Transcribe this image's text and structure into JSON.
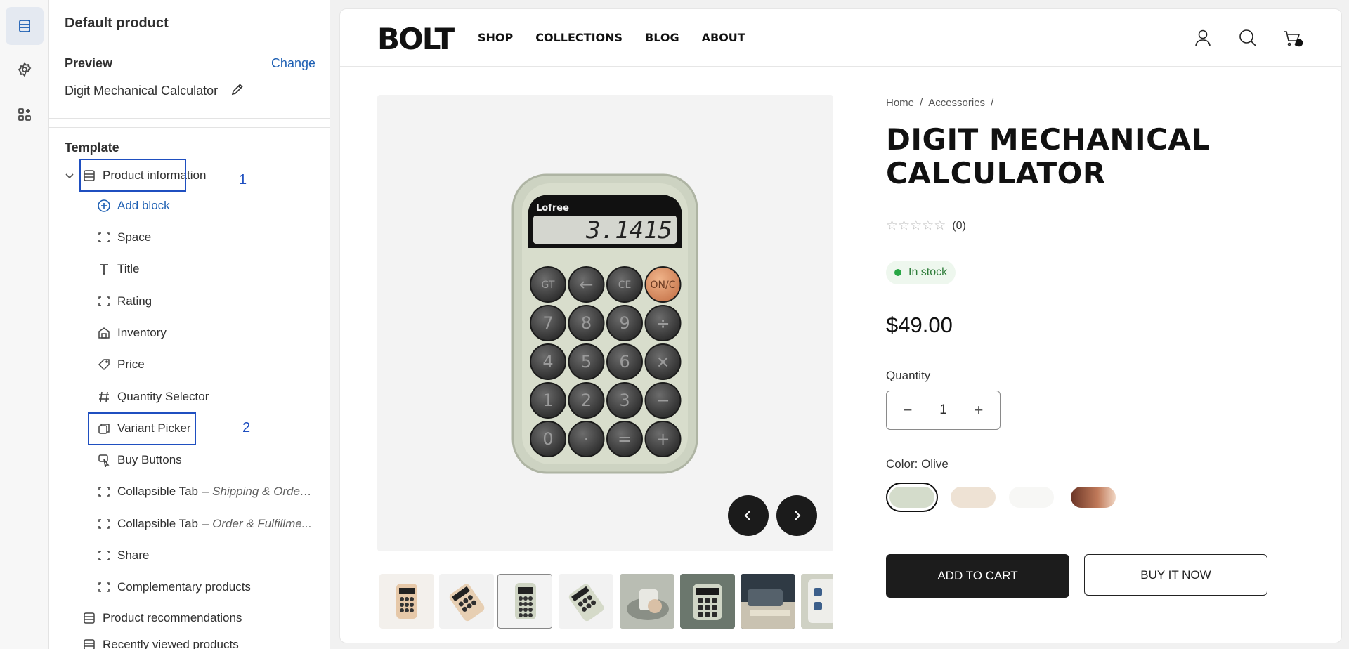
{
  "editor": {
    "panel_title": "Default product",
    "preview_label": "Preview",
    "change_label": "Change",
    "preview_product": "Digit Mechanical Calculator",
    "template_label": "Template",
    "section": "Product information",
    "add_block": "Add block",
    "blocks": [
      {
        "label": "Space",
        "sub": "",
        "icon": "section-bracket-icon"
      },
      {
        "label": "Title",
        "sub": "",
        "icon": "text-icon"
      },
      {
        "label": "Rating",
        "sub": "",
        "icon": "section-bracket-icon"
      },
      {
        "label": "Inventory",
        "sub": "",
        "icon": "inventory-icon"
      },
      {
        "label": "Price",
        "sub": "",
        "icon": "price-tag-icon"
      },
      {
        "label": "Quantity Selector",
        "sub": "",
        "icon": "hash-icon"
      },
      {
        "label": "Variant Picker",
        "sub": "",
        "icon": "variant-icon"
      },
      {
        "label": "Buy Buttons",
        "sub": "",
        "icon": "cursor-click-icon"
      },
      {
        "label": "Collapsible Tab",
        "sub": "– Shipping & Order ...",
        "icon": "section-bracket-icon"
      },
      {
        "label": "Collapsible Tab",
        "sub": "– Order & Fulfillme...",
        "icon": "section-bracket-icon"
      },
      {
        "label": "Share",
        "sub": "",
        "icon": "section-bracket-icon"
      },
      {
        "label": "Complementary products",
        "sub": "",
        "icon": "section-bracket-icon"
      }
    ],
    "sections_after": [
      "Product recommendations",
      "Recently viewed products"
    ],
    "annotations": [
      "1",
      "2"
    ]
  },
  "store": {
    "logo": "BOLT",
    "nav": [
      "SHOP",
      "COLLECTIONS",
      "BLOG",
      "ABOUT"
    ],
    "breadcrumb": [
      "Home",
      "/",
      "Accessories",
      "/"
    ],
    "title_line1": "DIGIT MECHANICAL",
    "title_line2": "CALCULATOR",
    "rating_count": "(0)",
    "rating_value": 0,
    "stock": "In stock",
    "price": "$49.00",
    "quantity_label": "Quantity",
    "quantity": "1",
    "color_label": "Color: Olive",
    "swatches": [
      "#d4dccb",
      "#eee2d4",
      "#f7f7f5",
      "#8a4a34"
    ],
    "add_to_cart": "ADD TO CART",
    "buy_now": "BUY IT NOW",
    "calculator": {
      "brand": "Lofree",
      "display": "3.1415",
      "keys": [
        "GT",
        "←",
        "CE",
        "ON/C",
        "7",
        "8",
        "9",
        "÷",
        "4",
        "5",
        "6",
        "×",
        "1",
        "2",
        "3",
        "−",
        "0",
        "·",
        "=",
        "+"
      ]
    }
  }
}
